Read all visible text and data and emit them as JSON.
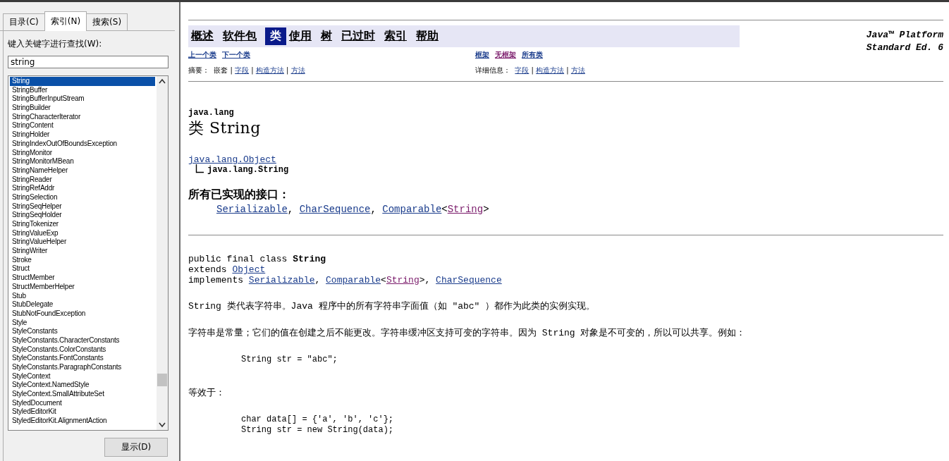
{
  "tabs": [
    {
      "label": "目录(C)",
      "selected": false
    },
    {
      "label": "索引(N)",
      "selected": true
    },
    {
      "label": "搜索(S)",
      "selected": false
    }
  ],
  "index_panel": {
    "prompt": "键入关键字进行查找(W):",
    "search": {
      "value": "string"
    },
    "items": [
      {
        "label": "String",
        "selected": true
      },
      {
        "label": "StringBuffer",
        "selected": false
      },
      {
        "label": "StringBufferInputStream",
        "selected": false
      },
      {
        "label": "StringBuilder",
        "selected": false
      },
      {
        "label": "StringCharacterIterator",
        "selected": false
      },
      {
        "label": "StringContent",
        "selected": false
      },
      {
        "label": "StringHolder",
        "selected": false
      },
      {
        "label": "StringIndexOutOfBoundsException",
        "selected": false
      },
      {
        "label": "StringMonitor",
        "selected": false
      },
      {
        "label": "StringMonitorMBean",
        "selected": false
      },
      {
        "label": "StringNameHelper",
        "selected": false
      },
      {
        "label": "StringReader",
        "selected": false
      },
      {
        "label": "StringRefAddr",
        "selected": false
      },
      {
        "label": "StringSelection",
        "selected": false
      },
      {
        "label": "StringSeqHelper",
        "selected": false
      },
      {
        "label": "StringSeqHolder",
        "selected": false
      },
      {
        "label": "StringTokenizer",
        "selected": false
      },
      {
        "label": "StringValueExp",
        "selected": false
      },
      {
        "label": "StringValueHelper",
        "selected": false
      },
      {
        "label": "StringWriter",
        "selected": false
      },
      {
        "label": "Stroke",
        "selected": false
      },
      {
        "label": "Struct",
        "selected": false
      },
      {
        "label": "StructMember",
        "selected": false
      },
      {
        "label": "StructMemberHelper",
        "selected": false
      },
      {
        "label": "Stub",
        "selected": false
      },
      {
        "label": "StubDelegate",
        "selected": false
      },
      {
        "label": "StubNotFoundException",
        "selected": false
      },
      {
        "label": "Style",
        "selected": false
      },
      {
        "label": "StyleConstants",
        "selected": false
      },
      {
        "label": "StyleConstants.CharacterConstants",
        "selected": false
      },
      {
        "label": "StyleConstants.ColorConstants",
        "selected": false
      },
      {
        "label": "StyleConstants.FontConstants",
        "selected": false
      },
      {
        "label": "StyleConstants.ParagraphConstants",
        "selected": false
      },
      {
        "label": "StyleContext",
        "selected": false
      },
      {
        "label": "StyleContext.NamedStyle",
        "selected": false
      },
      {
        "label": "StyleContext.SmallAttributeSet",
        "selected": false
      },
      {
        "label": "StyledDocument",
        "selected": false
      },
      {
        "label": "StyledEditorKit",
        "selected": false
      },
      {
        "label": "StyledEditorKit.AlignmentAction",
        "selected": false
      }
    ],
    "display_button": "显示(D)"
  },
  "doc": {
    "nav": [
      {
        "label": "概述",
        "selected": false
      },
      {
        "label": "软件包",
        "selected": false
      },
      {
        "label": "类",
        "selected": true
      },
      {
        "label": "使用",
        "selected": false
      },
      {
        "label": "树",
        "selected": false
      },
      {
        "label": "已过时",
        "selected": false
      },
      {
        "label": "索引",
        "selected": false
      },
      {
        "label": "帮助",
        "selected": false
      }
    ],
    "platform_lines": [
      "Java™ Platform",
      "Standard Ed. 6"
    ],
    "prev_next": [
      "上一个类",
      "下一个类"
    ],
    "frame_links": [
      {
        "label": "框架",
        "visited": false
      },
      {
        "label": "无框架",
        "visited": true
      },
      {
        "label": "所有类",
        "visited": false
      }
    ],
    "summary": [
      {
        "text": "摘要：  嵌套 | ",
        "kind": "plain"
      },
      {
        "text": "字段",
        "kind": "link"
      },
      {
        "text": " | ",
        "kind": "plain"
      },
      {
        "text": "构造方法",
        "kind": "link"
      },
      {
        "text": " | ",
        "kind": "plain"
      },
      {
        "text": "方法",
        "kind": "link"
      }
    ],
    "detail": [
      {
        "text": "详细信息：  ",
        "kind": "plain"
      },
      {
        "text": "字段",
        "kind": "link"
      },
      {
        "text": " | ",
        "kind": "plain"
      },
      {
        "text": "构造方法",
        "kind": "link"
      },
      {
        "text": " | ",
        "kind": "plain"
      },
      {
        "text": "方法",
        "kind": "link"
      }
    ],
    "package": "java.lang",
    "title": "类 String",
    "superclass": "java.lang.Object",
    "class_name": "java.lang.String",
    "interfaces_heading": "所有已实现的接口：",
    "interfaces": [
      {
        "text": "Serializable",
        "kind": "link"
      },
      {
        "text": ", ",
        "kind": "plain"
      },
      {
        "text": "CharSequence",
        "kind": "link"
      },
      {
        "text": ", ",
        "kind": "plain"
      },
      {
        "text": "Comparable",
        "kind": "link"
      },
      {
        "text": "<",
        "kind": "plain"
      },
      {
        "text": "String",
        "kind": "visited"
      },
      {
        "text": ">",
        "kind": "plain"
      }
    ],
    "declaration": [
      [
        {
          "text": "public final class ",
          "kind": "plain"
        },
        {
          "text": "String",
          "kind": "bold"
        }
      ],
      [
        {
          "text": "extends ",
          "kind": "plain"
        },
        {
          "text": "Object",
          "kind": "link"
        }
      ],
      [
        {
          "text": "implements ",
          "kind": "plain"
        },
        {
          "text": "Serializable",
          "kind": "link"
        },
        {
          "text": ", ",
          "kind": "plain"
        },
        {
          "text": "Comparable",
          "kind": "link"
        },
        {
          "text": "<",
          "kind": "plain"
        },
        {
          "text": "String",
          "kind": "visited"
        },
        {
          "text": ">, ",
          "kind": "plain"
        },
        {
          "text": "CharSequence",
          "kind": "link"
        }
      ]
    ],
    "body": [
      {
        "kind": "para",
        "text": "String 类代表字符串。Java 程序中的所有字符串字面值（如 \"abc\" ）都作为此类的实例实现。"
      },
      {
        "kind": "para",
        "text": "字符串是常量；它们的值在创建之后不能更改。字符串缓冲区支持可变的字符串。因为 String 对象是不可变的，所以可以共享。例如："
      },
      {
        "kind": "code",
        "lines": [
          "String str = \"abc\";"
        ]
      },
      {
        "kind": "para",
        "text": "等效于："
      },
      {
        "kind": "code",
        "lines": [
          "char data[] = {'a', 'b', 'c'};",
          "String str = new String(data);"
        ]
      }
    ]
  }
}
